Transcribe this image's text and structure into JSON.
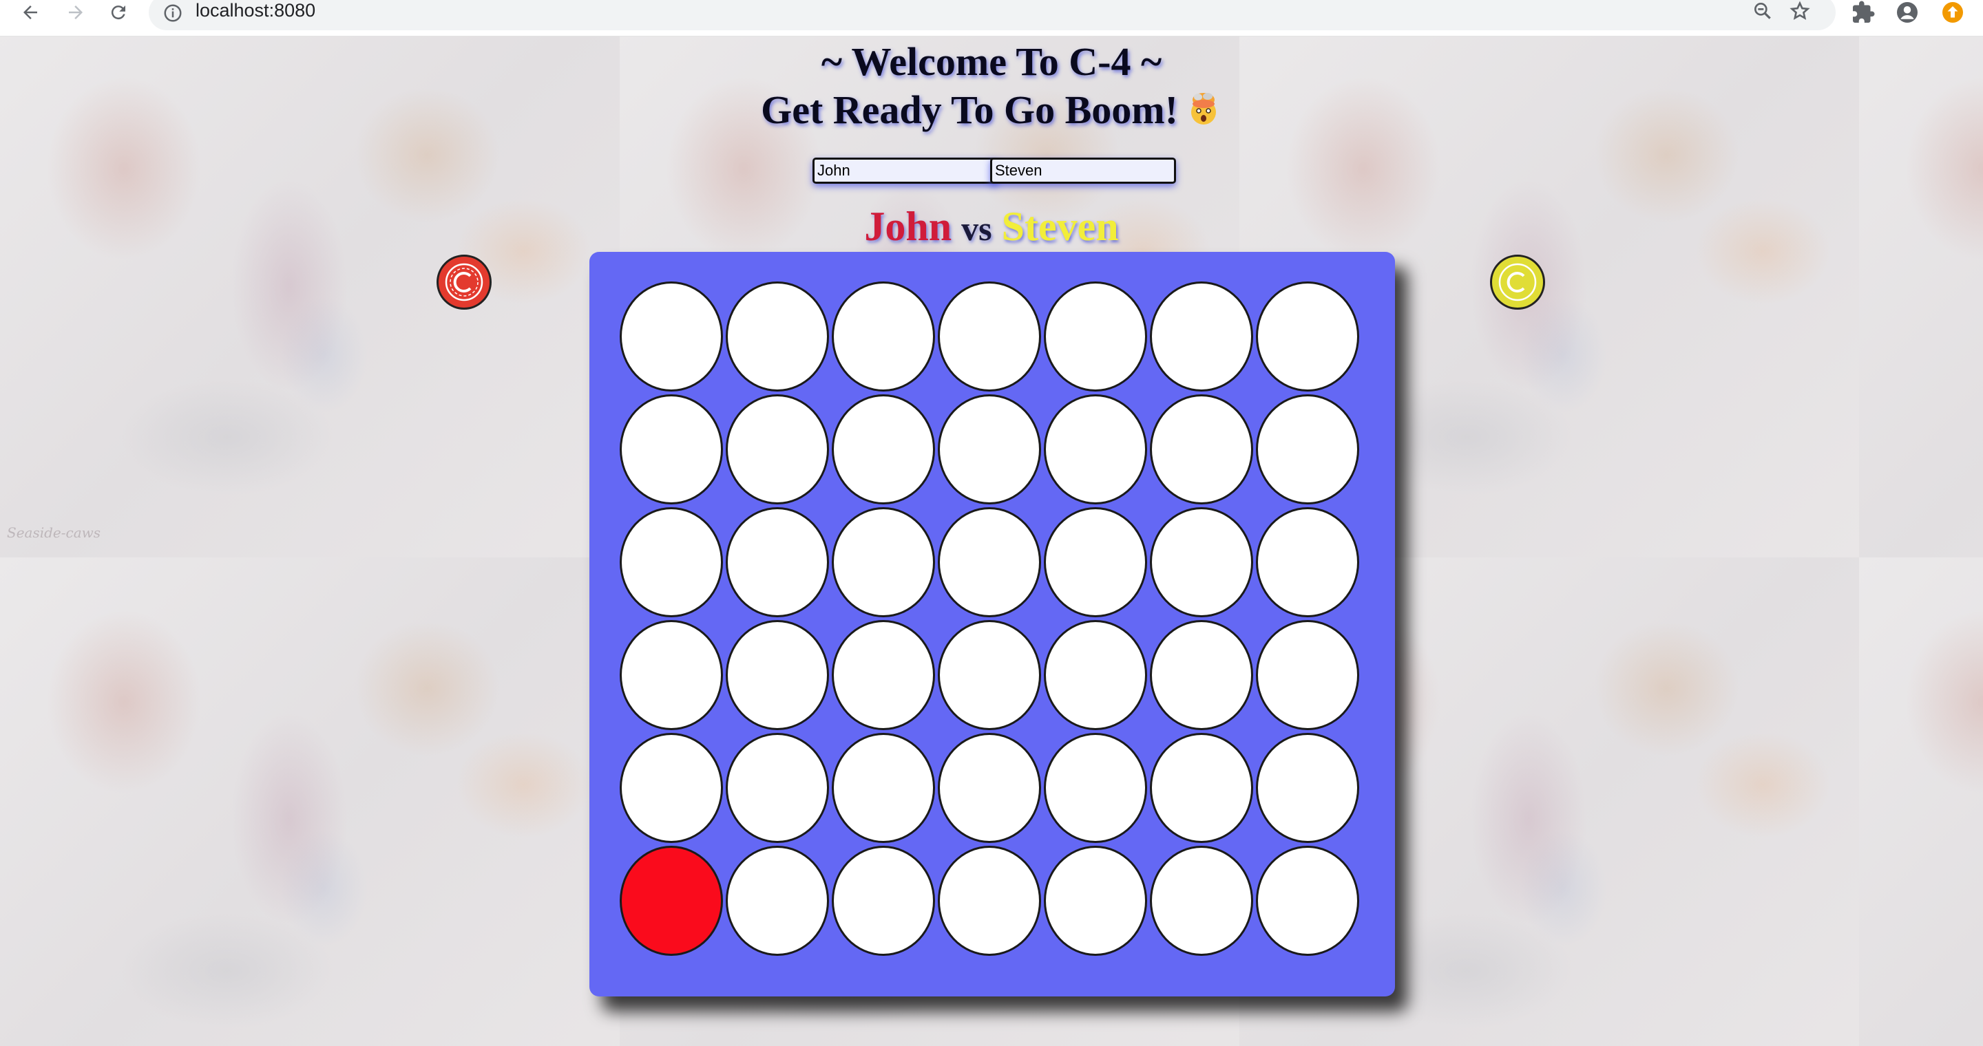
{
  "browser": {
    "url": "localhost:8080",
    "icons": [
      "back-icon",
      "forward-icon",
      "reload-icon",
      "info-icon",
      "zoom-icon",
      "star-icon",
      "extensions-icon",
      "profile-icon",
      "update-icon"
    ]
  },
  "header": {
    "title_line1": "~ Welcome To C-4 ~",
    "title_line2": "Get Ready To Go Boom!",
    "title_emoji": "exploding-head-icon"
  },
  "players": {
    "player1": {
      "input_value": "John",
      "name": "John",
      "color": "#d01c3a",
      "token_color": "#e33a2e"
    },
    "player2": {
      "input_value": "Steven",
      "name": "Steven",
      "color": "#f2ee3a",
      "token_color": "#e0dd36"
    },
    "vs_label": "vs"
  },
  "board": {
    "rows": 6,
    "columns": 7,
    "board_color": "#6468f4",
    "cells": [
      [
        "empty",
        "empty",
        "empty",
        "empty",
        "empty",
        "empty",
        "empty"
      ],
      [
        "empty",
        "empty",
        "empty",
        "empty",
        "empty",
        "empty",
        "empty"
      ],
      [
        "empty",
        "empty",
        "empty",
        "empty",
        "empty",
        "empty",
        "empty"
      ],
      [
        "empty",
        "empty",
        "empty",
        "empty",
        "empty",
        "empty",
        "empty"
      ],
      [
        "empty",
        "empty",
        "empty",
        "empty",
        "empty",
        "empty",
        "empty"
      ],
      [
        "red",
        "empty",
        "empty",
        "empty",
        "empty",
        "empty",
        "empty"
      ]
    ]
  },
  "background": {
    "watermark": "Seaside-caws"
  }
}
